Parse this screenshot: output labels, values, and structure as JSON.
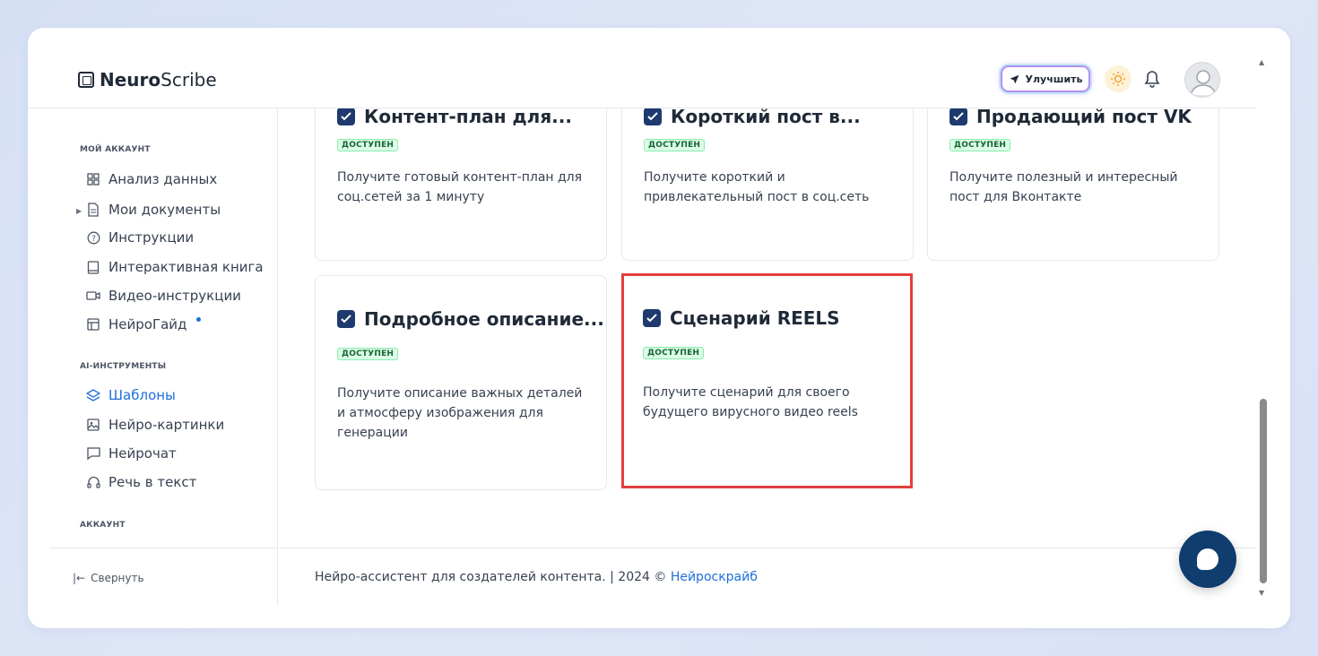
{
  "header": {
    "logo_bold": "Neuro",
    "logo_rest": "Scribe",
    "upgrade_label": "Улучшить"
  },
  "sidebar": {
    "section_account": "МОЙ АККАУНТ",
    "items_account": [
      {
        "label": "Анализ данных",
        "icon": "grid-icon"
      },
      {
        "label": "Мои документы",
        "icon": "document-icon"
      },
      {
        "label": "Инструкции",
        "icon": "help-icon"
      },
      {
        "label": "Интерактивная книга",
        "icon": "book-icon"
      },
      {
        "label": "Видео-инструкции",
        "icon": "video-icon"
      },
      {
        "label": "НейроГайд",
        "icon": "layout-icon"
      }
    ],
    "section_ai": "AI-ИНСТРУМЕНТЫ",
    "items_ai": [
      {
        "label": "Шаблоны",
        "icon": "layers-icon",
        "active": true
      },
      {
        "label": "Нейро-картинки",
        "icon": "image-icon"
      },
      {
        "label": "Нейрочат",
        "icon": "chat-icon"
      },
      {
        "label": "Речь в текст",
        "icon": "headphones-icon"
      }
    ],
    "section_profile": "АККАУНТ",
    "collapse_label": "Свернуть"
  },
  "cards": [
    {
      "title": "Контент-план для...",
      "badge": "ДОСТУПЕН",
      "desc": "Получите готовый контент-план для соц.сетей за 1 минуту"
    },
    {
      "title": "Короткий пост в...",
      "badge": "ДОСТУПЕН",
      "desc": "Получите короткий и привлекательный пост в соц.сеть"
    },
    {
      "title": "Продающий пост VK",
      "badge": "ДОСТУПЕН",
      "desc": "Получите полезный и интересный пост для Вконтакте"
    },
    {
      "title": "Подробное описание...",
      "badge": "ДОСТУПЕН",
      "desc": "Получите описание важных деталей и атмосферу изображения для генерации"
    },
    {
      "title": "Сценарий REELS",
      "badge": "ДОСТУПЕН",
      "desc": "Получите сценарий для своего будущего вирусного видео reels"
    }
  ],
  "footer": {
    "text": "Нейро-ассистент для создателей контента.  | 2024 © ",
    "link": "Нейроскрайб"
  },
  "colors": {
    "accent": "#1e6fd9",
    "highlight": "#e53e3e",
    "badge_bg": "#dcfce7",
    "chat_button": "#0f3d6e"
  }
}
